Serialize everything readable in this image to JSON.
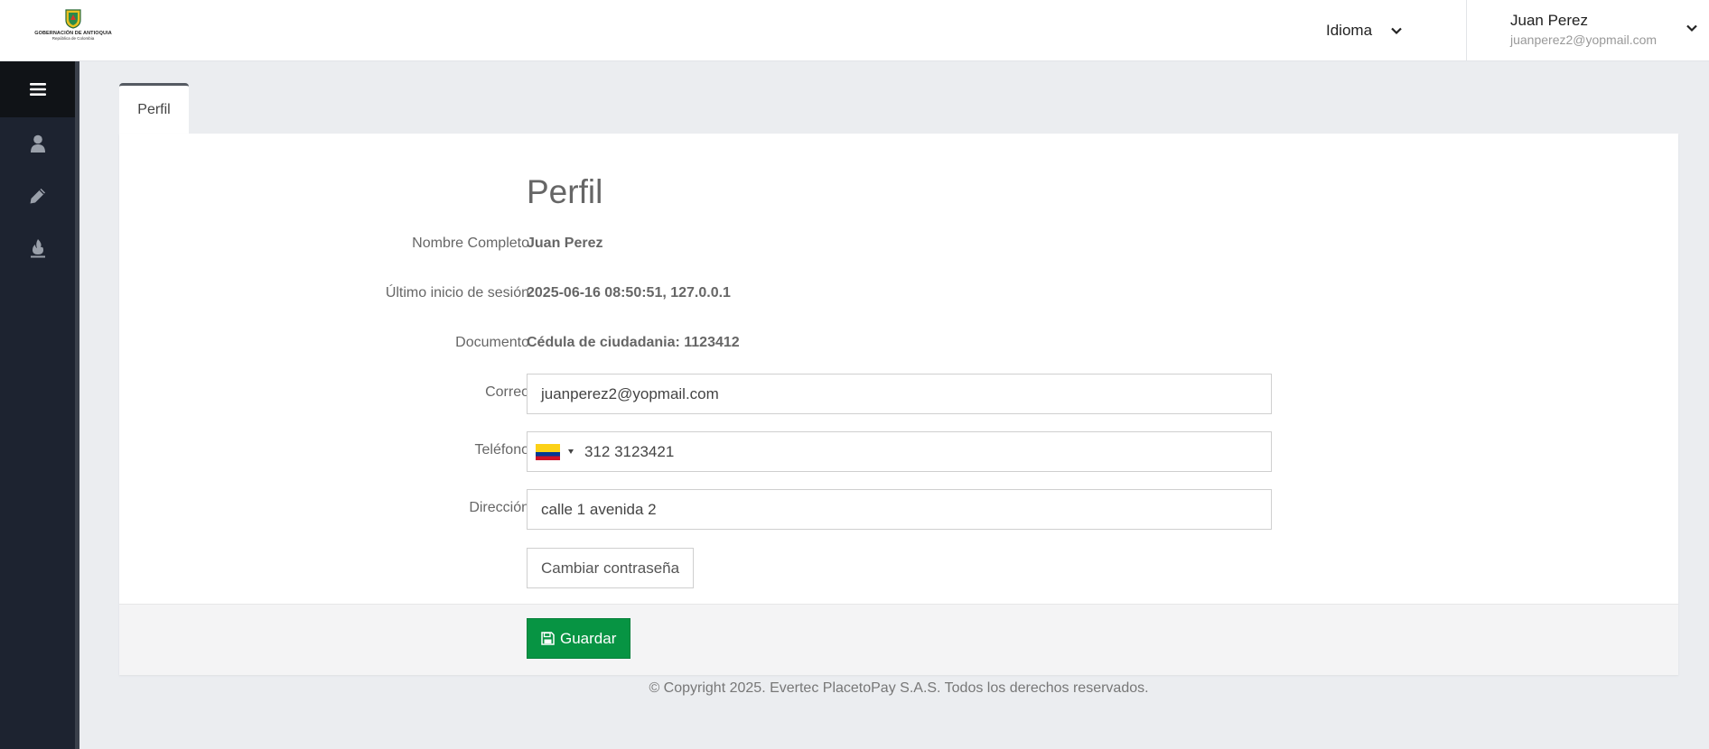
{
  "header": {
    "logo": {
      "line1": "GOBERNACIÓN DE ANTIOQUIA",
      "line2": "República de Colombia"
    },
    "language_label": "Idioma",
    "user": {
      "name": "Juan Perez",
      "email": "juanperez2@yopmail.com"
    }
  },
  "sidebar": {
    "items": [
      {
        "icon": "user-icon"
      },
      {
        "icon": "pencil-icon"
      },
      {
        "icon": "fire-icon"
      }
    ]
  },
  "tab": {
    "label": "Perfil"
  },
  "profile": {
    "title": "Perfil",
    "rows": [
      {
        "label": "Nombre Completo",
        "value": "Juan Perez"
      },
      {
        "label": "Último inicio de sesión",
        "value": "2025-06-16 08:50:51, 127.0.0.1"
      },
      {
        "label": "Documento",
        "value": "Cédula de ciudadania: 1123412"
      }
    ],
    "email": {
      "label": "Correo",
      "value": "juanperez2@yopmail.com"
    },
    "phone": {
      "label": "Teléfono",
      "value": "312 3123421",
      "country_flag": "colombia-flag-icon"
    },
    "address": {
      "label": "Dirección",
      "value": "calle 1 avenida 2"
    },
    "change_password_label": "Cambiar contraseña",
    "save_label": "Guardar"
  },
  "footer": {
    "copyright": "© Copyright 2025. Evertec PlacetoPay S.A.S. Todos los derechos reservados."
  },
  "colors": {
    "sidebar_bg": "#1d2330",
    "sidebar_toggle_bg": "#101317",
    "save_button": "#079443",
    "page_bg": "#ebedf0"
  }
}
